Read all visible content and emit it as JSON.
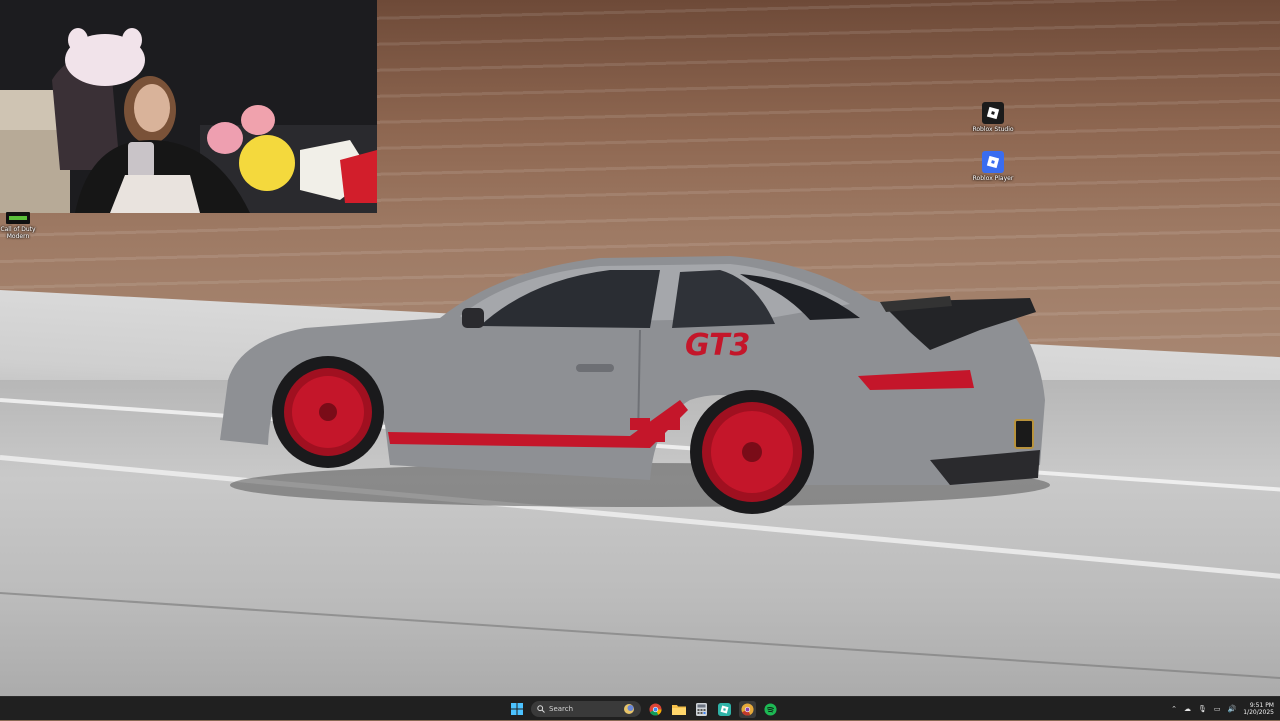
{
  "desktop": {
    "icons": [
      {
        "label": "Roblox Studio",
        "icon": "roblox-studio-icon"
      },
      {
        "label": "Roblox Player",
        "icon": "roblox-player-icon"
      },
      {
        "label": "Call of Duty Modern",
        "icon": "call-of-duty-icon"
      }
    ]
  },
  "wallpaper": {
    "car_decal": "GT3",
    "body_color": "#8e9094",
    "accent_color": "#c4162a"
  },
  "taskbar": {
    "search_placeholder": "Search",
    "apps": [
      "start-icon",
      "search-icon",
      "chrome-icon",
      "file-explorer-icon",
      "calculator-icon",
      "roblox-icon",
      "chrome-canary-icon",
      "spotify-icon"
    ],
    "tray": {
      "time": "9:51 PM",
      "date": "1/20/2025"
    }
  }
}
